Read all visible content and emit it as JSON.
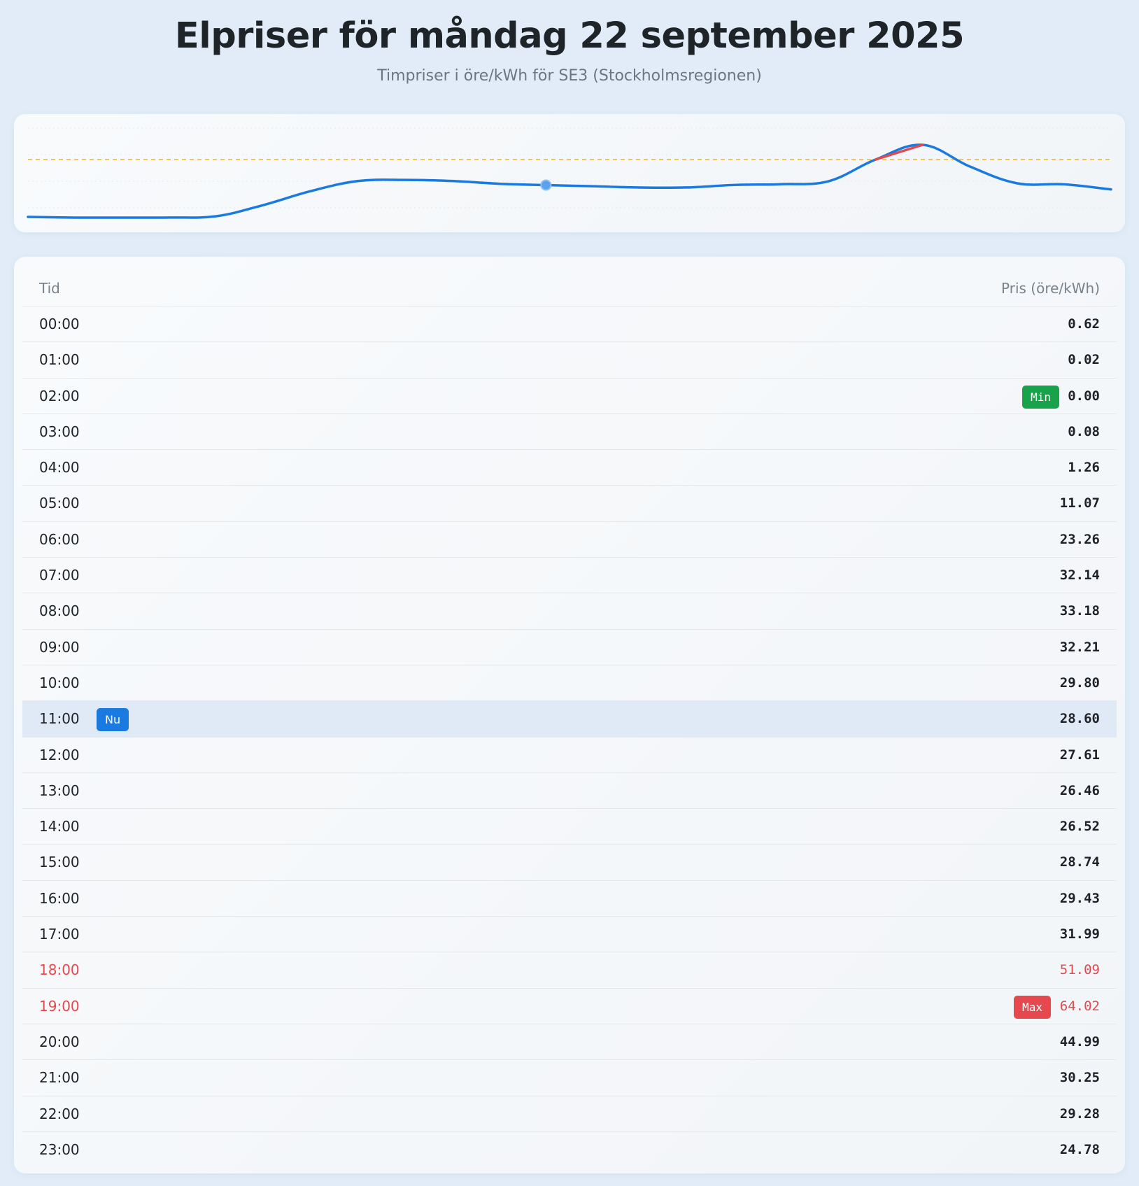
{
  "header": {
    "title": "Elpriser för måndag 22 september 2025",
    "subtitle": "Timpriser i öre/kWh för SE3 (Stockholmsregionen)"
  },
  "colors": {
    "line": "#1a7ae0",
    "high": "#e5484d",
    "average_line": "#f0b429",
    "min_badge": "#18a34a",
    "now_badge": "#1a7ae0",
    "current_row_bg": "#dfeaf6"
  },
  "table": {
    "col_time": "Tid",
    "col_price": "Pris (öre/kWh)",
    "rows": [
      {
        "time": "00:00",
        "price": "0.62"
      },
      {
        "time": "01:00",
        "price": "0.02"
      },
      {
        "time": "02:00",
        "price": "0.00",
        "badge": "Min",
        "badge_type": "min"
      },
      {
        "time": "03:00",
        "price": "0.08"
      },
      {
        "time": "04:00",
        "price": "1.26"
      },
      {
        "time": "05:00",
        "price": "11.07"
      },
      {
        "time": "06:00",
        "price": "23.26"
      },
      {
        "time": "07:00",
        "price": "32.14"
      },
      {
        "time": "08:00",
        "price": "33.18"
      },
      {
        "time": "09:00",
        "price": "32.21"
      },
      {
        "time": "10:00",
        "price": "29.80"
      },
      {
        "time": "11:00",
        "price": "28.60",
        "badge": "Nu",
        "badge_type": "now",
        "current": true
      },
      {
        "time": "12:00",
        "price": "27.61"
      },
      {
        "time": "13:00",
        "price": "26.46"
      },
      {
        "time": "14:00",
        "price": "26.52"
      },
      {
        "time": "15:00",
        "price": "28.74"
      },
      {
        "time": "16:00",
        "price": "29.43"
      },
      {
        "time": "17:00",
        "price": "31.99"
      },
      {
        "time": "18:00",
        "price": "51.09",
        "high": true
      },
      {
        "time": "19:00",
        "price": "64.02",
        "badge": "Max",
        "badge_type": "max",
        "high": true
      },
      {
        "time": "20:00",
        "price": "44.99"
      },
      {
        "time": "21:00",
        "price": "30.25"
      },
      {
        "time": "22:00",
        "price": "29.28"
      },
      {
        "time": "23:00",
        "price": "24.78"
      }
    ]
  },
  "chart_data": {
    "type": "line",
    "x": [
      "00:00",
      "01:00",
      "02:00",
      "03:00",
      "04:00",
      "05:00",
      "06:00",
      "07:00",
      "08:00",
      "09:00",
      "10:00",
      "11:00",
      "12:00",
      "13:00",
      "14:00",
      "15:00",
      "16:00",
      "17:00",
      "18:00",
      "19:00",
      "20:00",
      "21:00",
      "22:00",
      "23:00"
    ],
    "series": [
      {
        "values": [
          0.62,
          0.02,
          0.0,
          0.08,
          1.26,
          11.07,
          23.26,
          32.14,
          33.18,
          32.21,
          29.8,
          28.6,
          27.61,
          26.46,
          26.52,
          28.74,
          29.43,
          31.99,
          51.09,
          64.02,
          44.99,
          30.25,
          29.28,
          24.78
        ]
      }
    ],
    "reference_line": 51.09,
    "current_index": 11,
    "high_segment": [
      18,
      19
    ],
    "grid": false,
    "legend": "none"
  }
}
